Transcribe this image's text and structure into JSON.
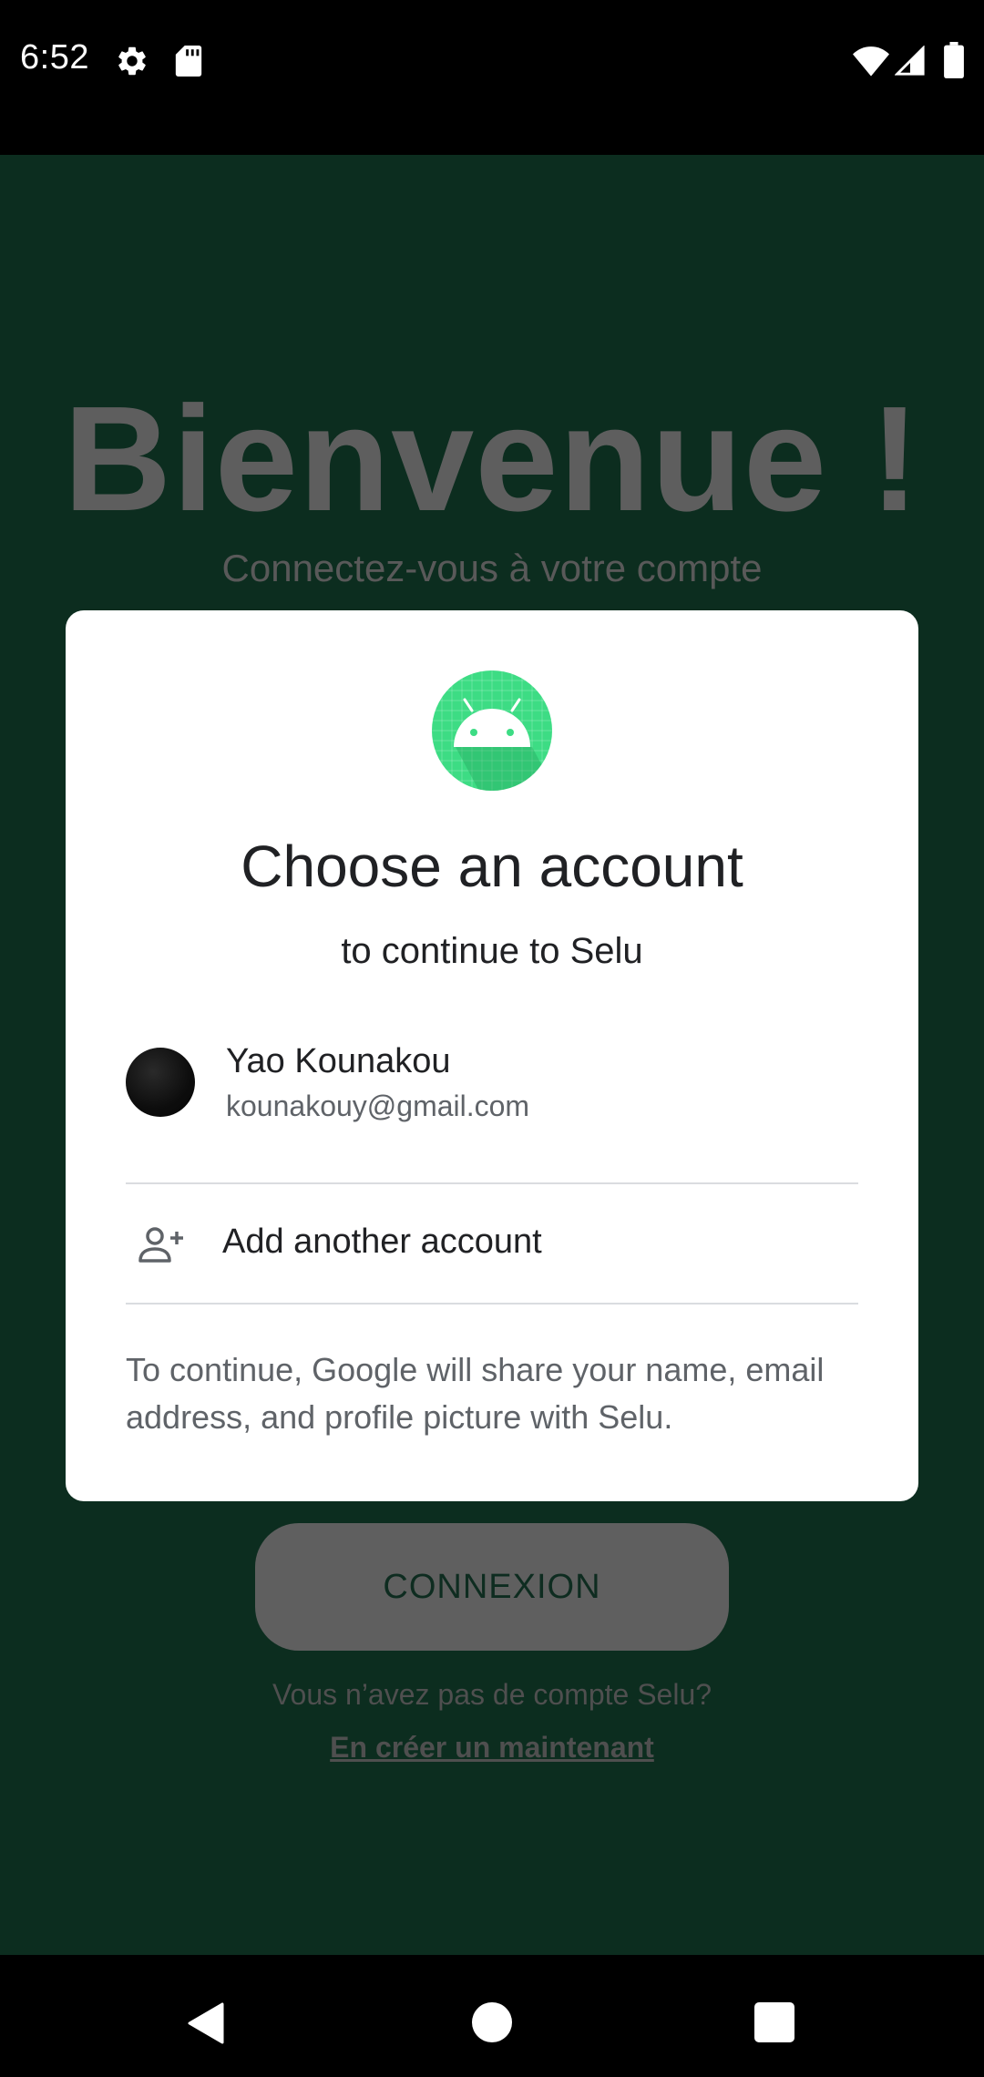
{
  "status_bar": {
    "time": "6:52",
    "icons": [
      "gear-icon",
      "sd-card-icon",
      "wifi-icon",
      "cell-signal-icon",
      "battery-icon"
    ]
  },
  "screen": {
    "welcome_title": "Bienvenue !",
    "welcome_subtitle": "Connectez-vous à votre compte",
    "connexion_label": "CONNEXION",
    "no_account_text": "Vous n’avez pas de compte Selu?",
    "create_account_link": "En créer un maintenant",
    "background_color": "#0c2d1f"
  },
  "dialog": {
    "logo_icon": "android-logo-icon",
    "title": "Choose an account",
    "subtitle": "to continue to Selu",
    "account": {
      "name": "Yao Kounakou",
      "email": "kounakouy@gmail.com"
    },
    "add_account_label": "Add another account",
    "add_account_icon": "add-person-icon",
    "disclaimer": "To continue, Google will share your name, email address, and profile picture with Selu.",
    "accent_color": "#3ddc84"
  },
  "nav_bar": {
    "icons": [
      "back-icon",
      "home-icon",
      "recent-apps-icon"
    ]
  }
}
